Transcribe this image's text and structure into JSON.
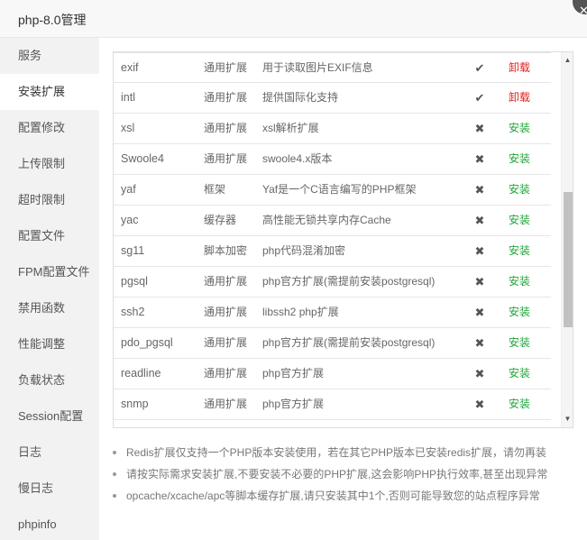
{
  "window": {
    "title": "php-8.0管理"
  },
  "sidebar": {
    "items": [
      {
        "label": "服务",
        "active": false
      },
      {
        "label": "安装扩展",
        "active": true
      },
      {
        "label": "配置修改",
        "active": false
      },
      {
        "label": "上传限制",
        "active": false
      },
      {
        "label": "超时限制",
        "active": false
      },
      {
        "label": "配置文件",
        "active": false
      },
      {
        "label": "FPM配置文件",
        "active": false
      },
      {
        "label": "禁用函数",
        "active": false
      },
      {
        "label": "性能调整",
        "active": false
      },
      {
        "label": "负载状态",
        "active": false
      },
      {
        "label": "Session配置",
        "active": false
      },
      {
        "label": "日志",
        "active": false
      },
      {
        "label": "慢日志",
        "active": false
      },
      {
        "label": "phpinfo",
        "active": false
      }
    ]
  },
  "extensions": {
    "rows": [
      {
        "name": "exif",
        "type": "通用扩展",
        "desc": "用于读取图片EXIF信息",
        "status": "✔",
        "installed": true,
        "op": "卸载"
      },
      {
        "name": "intl",
        "type": "通用扩展",
        "desc": "提供国际化支持",
        "status": "✔",
        "installed": true,
        "op": "卸载"
      },
      {
        "name": "xsl",
        "type": "通用扩展",
        "desc": "xsl解析扩展",
        "status": "✖",
        "installed": false,
        "op": "安装"
      },
      {
        "name": "Swoole4",
        "type": "通用扩展",
        "desc": "swoole4.x版本",
        "status": "✖",
        "installed": false,
        "op": "安装"
      },
      {
        "name": "yaf",
        "type": "框架",
        "desc": "Yaf是一个C语言编写的PHP框架",
        "status": "✖",
        "installed": false,
        "op": "安装"
      },
      {
        "name": "yac",
        "type": "缓存器",
        "desc": "高性能无锁共享内存Cache",
        "status": "✖",
        "installed": false,
        "op": "安装"
      },
      {
        "name": "sg11",
        "type": "脚本加密",
        "desc": "php代码混淆加密",
        "status": "✖",
        "installed": false,
        "op": "安装"
      },
      {
        "name": "pgsql",
        "type": "通用扩展",
        "desc": "php官方扩展(需提前安装postgresql)",
        "status": "✖",
        "installed": false,
        "op": "安装"
      },
      {
        "name": "ssh2",
        "type": "通用扩展",
        "desc": "libssh2 php扩展",
        "status": "✖",
        "installed": false,
        "op": "安装"
      },
      {
        "name": "pdo_pgsql",
        "type": "通用扩展",
        "desc": "php官方扩展(需提前安装postgresql)",
        "status": "✖",
        "installed": false,
        "op": "安装"
      },
      {
        "name": "readline",
        "type": "通用扩展",
        "desc": "php官方扩展",
        "status": "✖",
        "installed": false,
        "op": "安装"
      },
      {
        "name": "snmp",
        "type": "通用扩展",
        "desc": "php官方扩展",
        "status": "✖",
        "installed": false,
        "op": "安装"
      }
    ]
  },
  "scrollbar": {
    "up": "▲",
    "down": "▼"
  },
  "tips": [
    "Redis扩展仅支持一个PHP版本安装使用，若在其它PHP版本已安装redis扩展，请勿再装",
    "请按实际需求安装扩展,不要安装不必要的PHP扩展,这会影响PHP执行效率,甚至出现异常",
    "opcache/xcache/apc等脚本缓存扩展,请只安装其中1个,否则可能导致您的站点程序异常"
  ],
  "colors": {
    "install": "#20a53a",
    "uninstall": "#e02020",
    "sidebar_bg": "#f2f2f2"
  }
}
